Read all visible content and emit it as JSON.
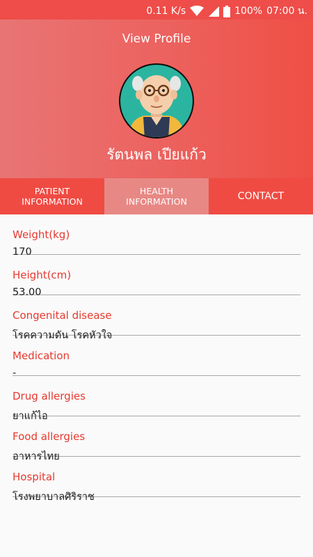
{
  "status_bar": {
    "speed": "0.11 K/s",
    "battery": "100%",
    "time": "07:00 น.",
    "icons": [
      "wifi-icon",
      "signal-icon",
      "battery-icon"
    ]
  },
  "header": {
    "title": "View Profile",
    "name": "รัตนพล เปียแก้ว",
    "gradient_colors": [
      "#e87574",
      "#ef4f45"
    ]
  },
  "tabs": [
    {
      "label": "PATIENT\nINFORMATION",
      "active": false
    },
    {
      "label": "HEALTH\nINFORMATION",
      "active": true
    },
    {
      "label": "CONTACT",
      "active": false
    }
  ],
  "fields": [
    {
      "label": "Weight(kg)",
      "value": "170"
    },
    {
      "label": "Height(cm)",
      "value": "53.00"
    },
    {
      "label": "Congenital disease",
      "value": "โรคความดัน โรคหัวใจ"
    },
    {
      "label": "Medication",
      "value": "-"
    },
    {
      "label": "Drug allergies",
      "value": "ยาแก้ไอ"
    },
    {
      "label": "Food allergies",
      "value": "อาหารไทย"
    },
    {
      "label": "Hospital",
      "value": "โรงพยาบาลศิริราช"
    }
  ],
  "colors": {
    "accent": "#e7392f",
    "tab_bar": "#ef4b43",
    "tab_active": "#e88884"
  }
}
